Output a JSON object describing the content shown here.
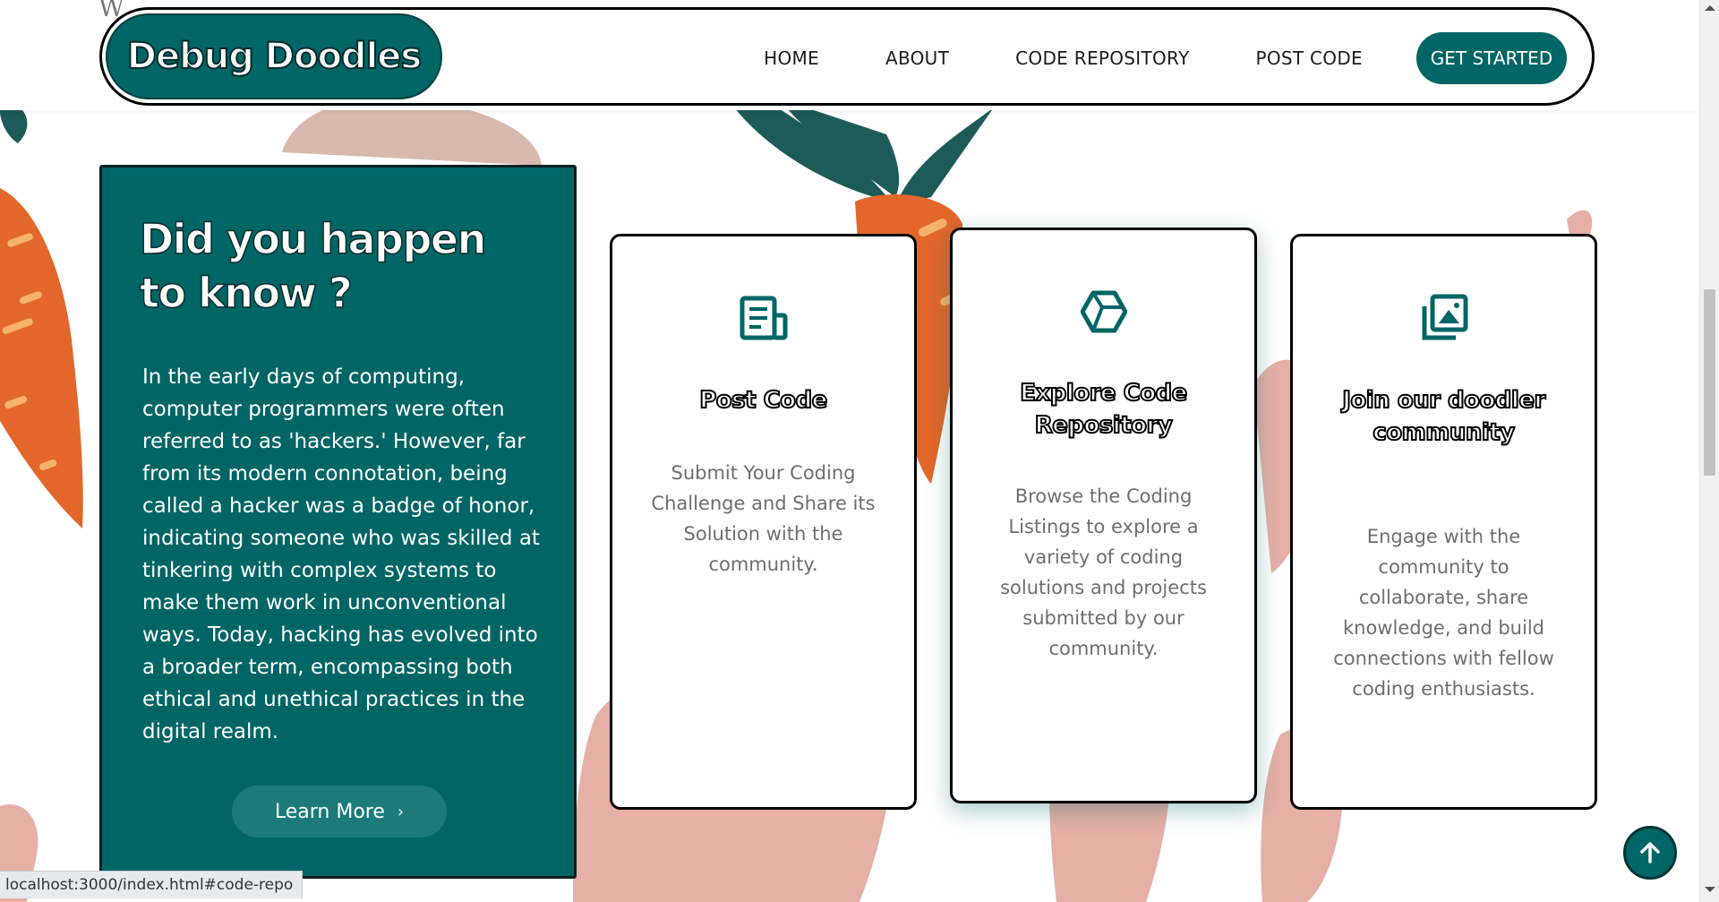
{
  "header": {
    "logo": "Debug Doodles",
    "stray_text": "W",
    "nav": [
      "HOME",
      "ABOUT",
      "CODE REPOSITORY",
      "POST CODE"
    ],
    "cta": "GET STARTED"
  },
  "fact_panel": {
    "title": "Did you happen to know ?",
    "body": "In the early days of computing, computer programmers were often referred to as 'hackers.' However, far from its modern connotation, being called a hacker was a badge of honor, indicating someone who was skilled at tinkering with complex systems to make them work in unconventional ways. Today, hacking has evolved into a broader term, encompassing both ethical and unethical practices in the digital realm.",
    "button": "Learn More",
    "button_chevron": "›"
  },
  "cards": [
    {
      "icon": "document-icon",
      "title": "Post Code",
      "description": "Submit Your Coding Challenge and Share its Solution with the community."
    },
    {
      "icon": "hexagon-box-icon",
      "title": "Explore Code Repository",
      "description": "Browse the Coding Listings to explore a variety of coding solutions and projects submitted by our community."
    },
    {
      "icon": "image-gallery-icon",
      "title": "Join our doodler community",
      "description": "Engage with the community to collaborate, share knowledge, and build connections with fellow coding enthusiasts."
    }
  ],
  "status_bar": {
    "url": "localhost:3000/index.html#code-repo"
  },
  "colors": {
    "primary": "#006565",
    "carrot_orange": "#e3672a",
    "carrot_leaf": "#1d5a5a",
    "bunny_pink": "#e6b0a6",
    "bunny_tan": "#cfb3a8"
  }
}
